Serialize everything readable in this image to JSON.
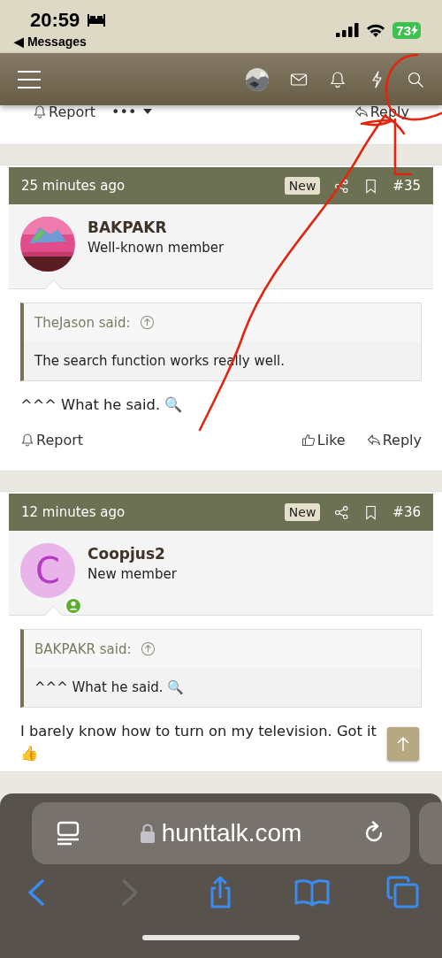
{
  "status_bar": {
    "time": "20:59",
    "back_label": "◀ Messages",
    "battery": "73"
  },
  "partial_post": {
    "actions": [
      {
        "kind": "report",
        "label": "Report"
      },
      {
        "kind": "more",
        "label": "•••"
      },
      {
        "kind": "reply",
        "label": "Reply"
      }
    ]
  },
  "posts": [
    {
      "time": "25 minutes ago",
      "badge": "New",
      "number": "#35",
      "user": {
        "name": "BAKPAKR",
        "title": "Well-known member"
      },
      "quote": {
        "author": "TheJason said:",
        "text": "The search function works really well."
      },
      "body": "^^^ What he said. 🔍",
      "actions": [
        {
          "kind": "report",
          "label": "Report"
        },
        {
          "kind": "like",
          "label": "Like"
        },
        {
          "kind": "reply",
          "label": "Reply"
        }
      ]
    },
    {
      "time": "12 minutes ago",
      "badge": "New",
      "number": "#36",
      "user": {
        "name": "Coopjus2",
        "title": "New member",
        "avatar": {
          "kind": "letter",
          "letter": "C",
          "color": "#e8b4ea",
          "online": true
        }
      },
      "quote": {
        "author": "BAKPAKR said:",
        "text": "^^^ What he said. 🔍"
      },
      "body": "I barely know how to turn on my television. Got it 👍"
    }
  ],
  "browser": {
    "url": "hunttalk.com",
    "toolbar": [
      {
        "kind": "back",
        "disabled": false
      },
      {
        "kind": "forward",
        "disabled": true
      },
      {
        "kind": "share",
        "disabled": false
      },
      {
        "kind": "bookmarks",
        "disabled": false
      },
      {
        "kind": "tabs",
        "disabled": false
      }
    ]
  }
}
